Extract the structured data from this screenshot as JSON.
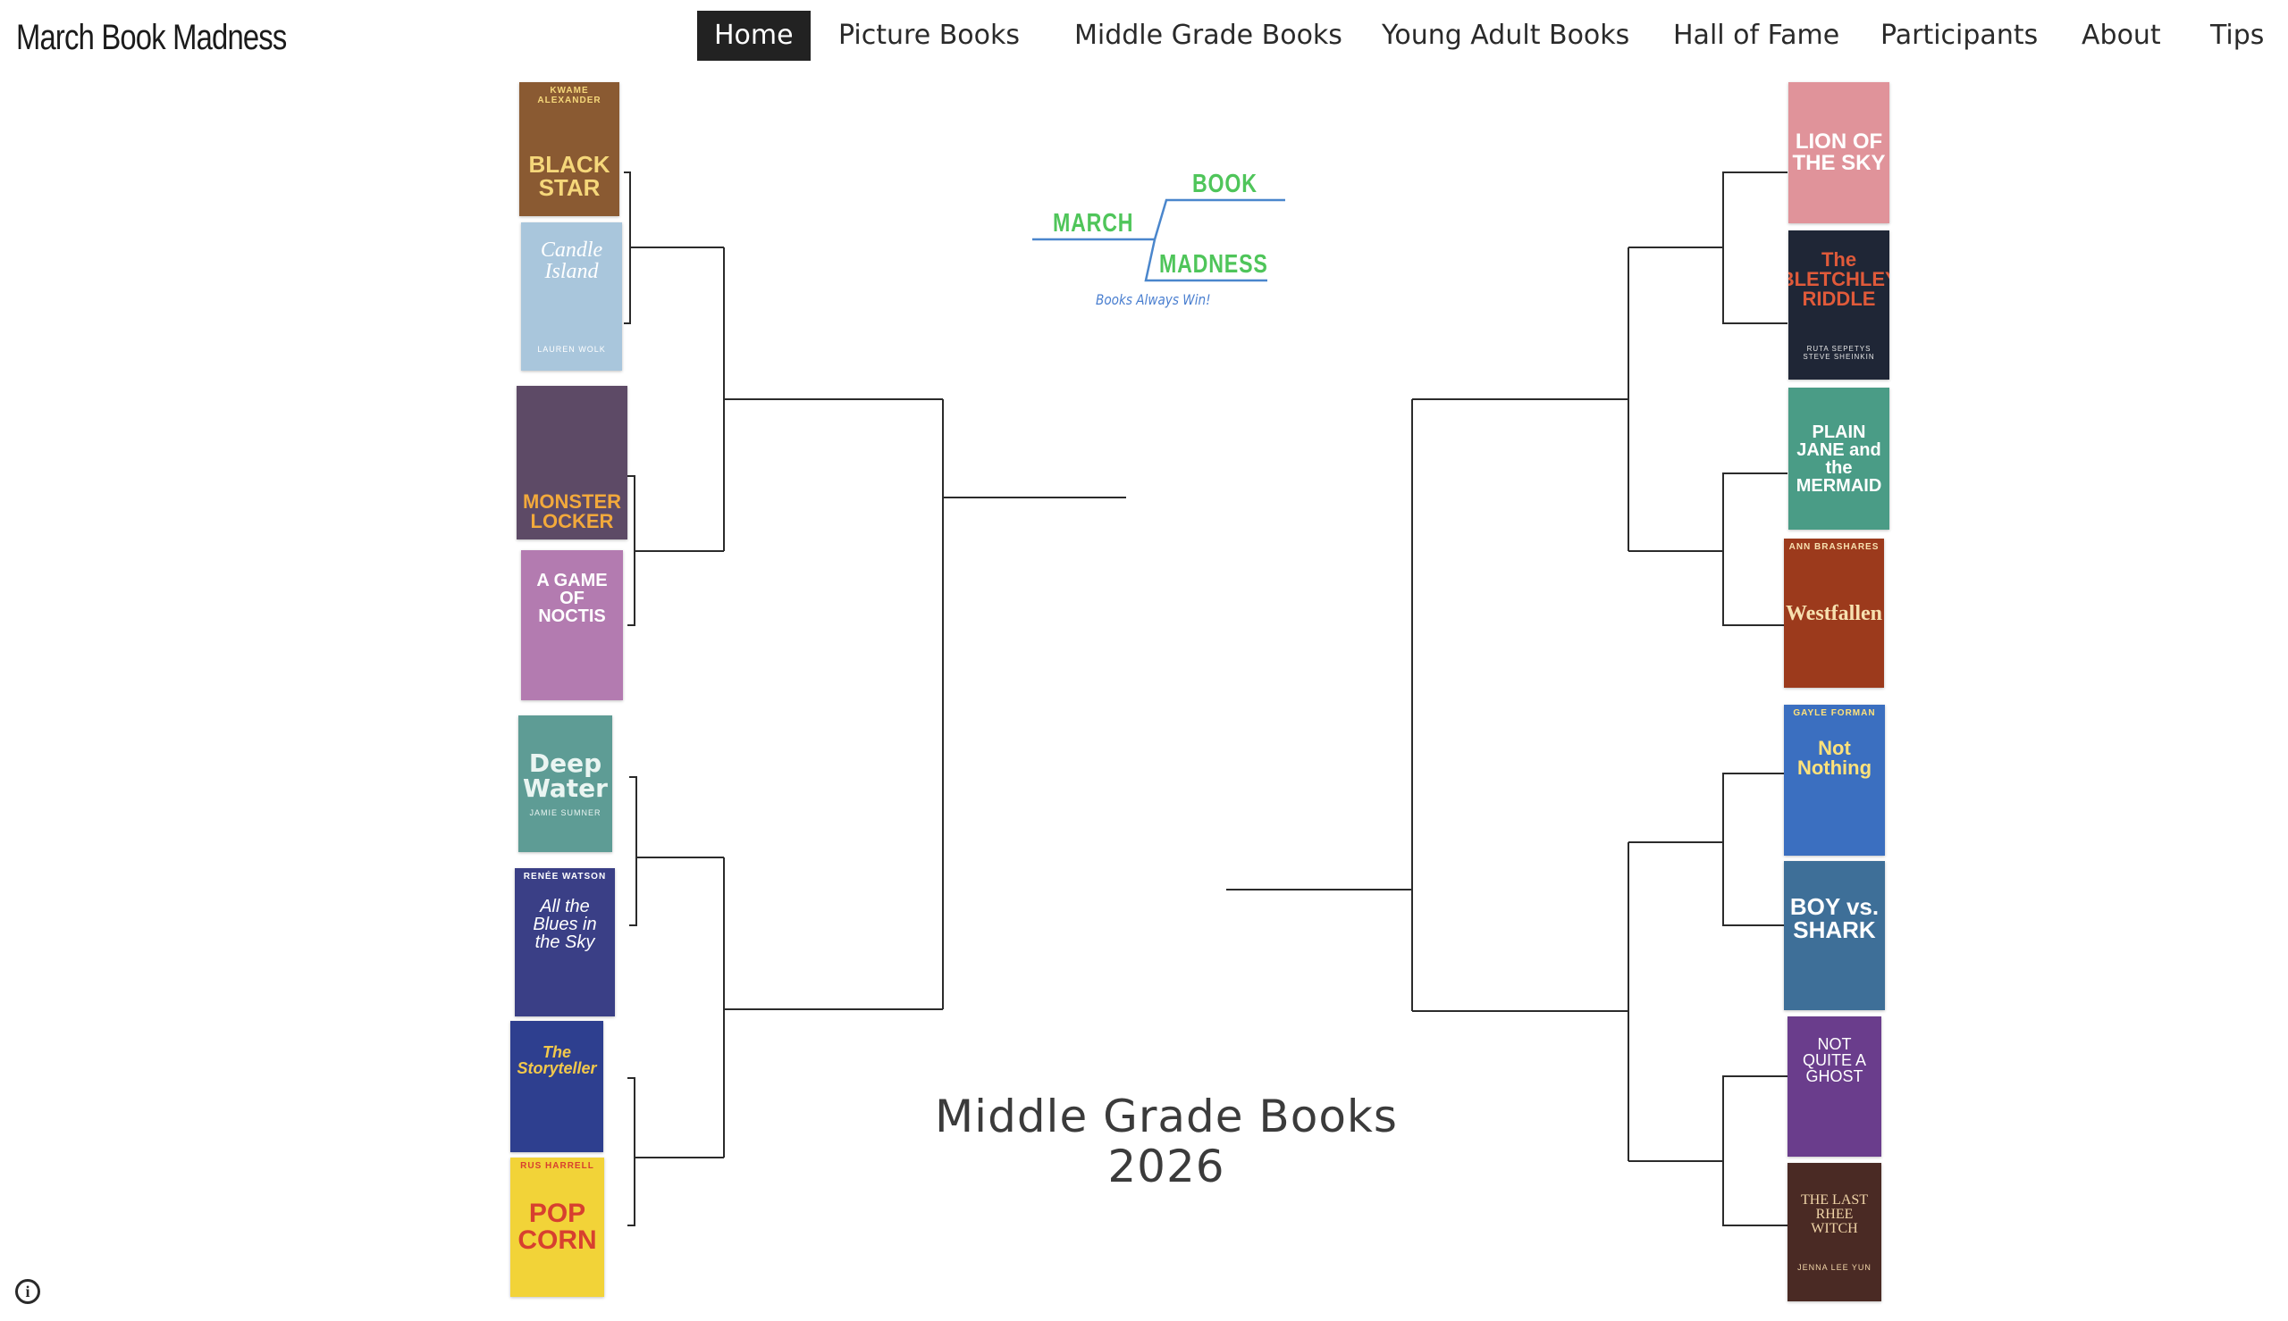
{
  "site": {
    "title": "March Book Madness"
  },
  "nav": {
    "items": [
      {
        "label": "Home",
        "active": true
      },
      {
        "label": "Picture Books"
      },
      {
        "label": "Middle Grade Books"
      },
      {
        "label": "Young Adult Books"
      },
      {
        "label": "Hall of Fame"
      },
      {
        "label": "Participants"
      },
      {
        "label": "About"
      },
      {
        "label": "Tips"
      }
    ]
  },
  "logo": {
    "word1": "MARCH",
    "word2": "BOOK",
    "word3": "MADNESS",
    "tagline": "Books Always Win!"
  },
  "bracket": {
    "title_line1": "Middle Grade Books",
    "title_line2": "2026"
  },
  "left_books": [
    {
      "top": "KWAME ALEXANDER",
      "title": "BLACK STAR",
      "author": "",
      "bg": "#8a5a32",
      "fg": "#f5d77a"
    },
    {
      "title": "Candle Island",
      "author": "LAUREN WOLK",
      "bg": "#a9c6dc",
      "fg": "#ffffff"
    },
    {
      "title": "MONSTER LOCKER",
      "author": "",
      "bg": "#5d4a66",
      "fg": "#f2a93b"
    },
    {
      "title": "A GAME OF NOCTIS",
      "author": "",
      "bg": "#b37bb0",
      "fg": "#ffffff"
    },
    {
      "title": "Deep Water",
      "author": "JAMIE SUMNER",
      "bg": "#5e9c95",
      "fg": "#eaf5f2"
    },
    {
      "top": "RENÉE WATSON",
      "title": "All the Blues in the Sky",
      "author": "",
      "bg": "#3a3f86",
      "fg": "#ffffff"
    },
    {
      "title": "The Storyteller",
      "author": "",
      "bg": "#2e3f8f",
      "fg": "#f2c84b"
    },
    {
      "top": "RUS HARRELL",
      "title": "POP CORN",
      "author": "",
      "bg": "#f2d338",
      "fg": "#d7402f"
    }
  ],
  "right_books": [
    {
      "title": "LION OF THE SKY",
      "author": "",
      "bg": "#e0939a",
      "fg": "#ffffff"
    },
    {
      "title": "The BLETCHLEY RIDDLE",
      "author": "RUTA SEPETYS  STEVE SHEINKIN",
      "bg": "#1f2636",
      "fg": "#e05a3a"
    },
    {
      "title": "PLAIN JANE and the MERMAID",
      "author": "",
      "bg": "#4a9c86",
      "fg": "#ffffff"
    },
    {
      "top": "ANN BRASHARES",
      "title": "Westfallen",
      "author": "",
      "bg": "#9c3a1c",
      "fg": "#f7e1b0"
    },
    {
      "top": "GAYLE FORMAN",
      "title": "Not Nothing",
      "author": "",
      "bg": "#3b6fc0",
      "fg": "#ffe27a"
    },
    {
      "title": "BOY vs. SHARK",
      "author": "",
      "bg": "#3e6f98",
      "fg": "#ffffff"
    },
    {
      "title": "NOT QUITE A GHOST",
      "author": "",
      "bg": "#6a3d8c",
      "fg": "#ffffff"
    },
    {
      "title": "THE LAST RHEE WITCH",
      "author": "JENNA LEE YUN",
      "bg": "#4a2a24",
      "fg": "#f1d5a8"
    }
  ],
  "info": {
    "icon": "info-icon",
    "glyph": "i"
  }
}
